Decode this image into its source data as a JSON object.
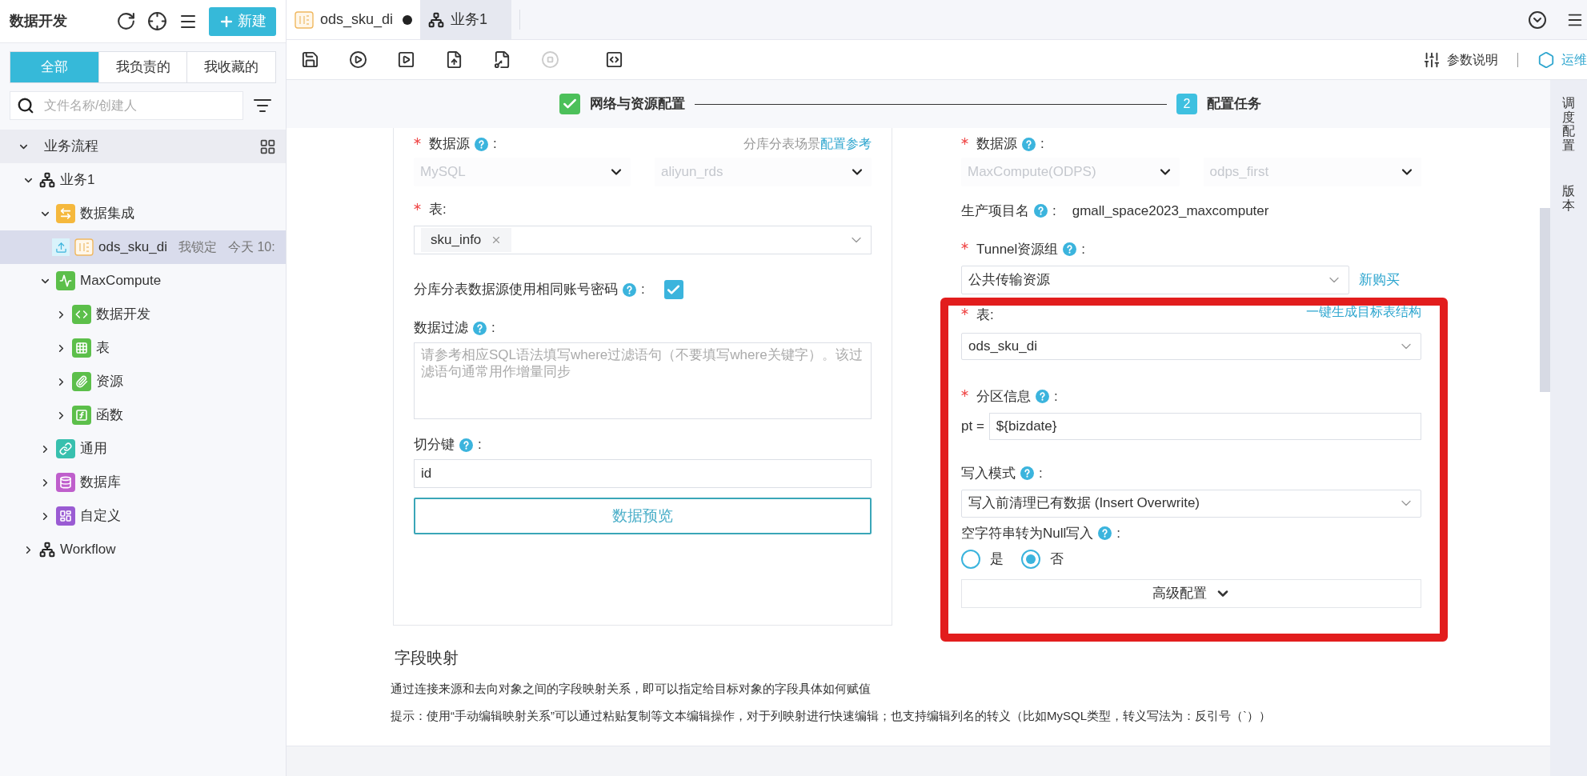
{
  "sidebar": {
    "title": "数据开发",
    "new_button": "新建",
    "filter_tabs": [
      {
        "label": "全部",
        "selected": true
      },
      {
        "label": "我负责的",
        "selected": false
      },
      {
        "label": "我收藏的",
        "selected": false
      }
    ],
    "search": {
      "placeholder": "文件名称/创建人"
    },
    "tree": [
      {
        "label": "业务流程",
        "kind": "section",
        "expanded": true,
        "selected": false,
        "children": [
          {
            "label": "业务1",
            "kind": "flow",
            "expanded": true,
            "selected": false,
            "children": [
              {
                "label": "数据集成",
                "kind": "integration",
                "expanded": true,
                "selected": false,
                "children": [
                  {
                    "label": "ods_sku_di",
                    "kind": "di",
                    "selected": true,
                    "lock": "我锁定",
                    "time": "今天 10:"
                  }
                ]
              },
              {
                "label": "MaxCompute",
                "kind": "maxcompute",
                "expanded": true,
                "selected": false,
                "children": [
                  {
                    "label": "数据开发",
                    "kind": "code",
                    "expanded": false,
                    "selected": false
                  },
                  {
                    "label": "表",
                    "kind": "table",
                    "expanded": false,
                    "selected": false
                  },
                  {
                    "label": "资源",
                    "kind": "resource",
                    "expanded": false,
                    "selected": false
                  },
                  {
                    "label": "函数",
                    "kind": "function",
                    "expanded": false,
                    "selected": false
                  }
                ]
              },
              {
                "label": "通用",
                "kind": "general",
                "expanded": false,
                "selected": false
              },
              {
                "label": "数据库",
                "kind": "database",
                "expanded": false,
                "selected": false
              },
              {
                "label": "自定义",
                "kind": "custom",
                "expanded": false,
                "selected": false
              }
            ]
          },
          {
            "label": "Workflow",
            "kind": "flow",
            "expanded": false,
            "selected": false
          }
        ]
      }
    ]
  },
  "editor_tabs": [
    {
      "label": "ods_sku_di",
      "kind": "di",
      "selected": true,
      "modified": true
    },
    {
      "label": "业务1",
      "kind": "flow",
      "selected": false,
      "modified": false
    }
  ],
  "toolbar": {
    "stop_disabled": true,
    "params_link": "参数说明",
    "ops_link": "运维"
  },
  "steps": [
    {
      "label": "网络与资源配置",
      "done": true
    },
    {
      "number": "2",
      "label": "配置任务",
      "done": false
    }
  ],
  "source": {
    "datasource_label": {
      "text": "数据源",
      "required": true,
      "help": true,
      "after": ":"
    },
    "hint_text": "分库分表场景",
    "hint_link": "配置参考",
    "type": "MySQL",
    "name": "aliyun_rds",
    "table_label": {
      "text": "表:",
      "required": true,
      "help": false
    },
    "tables": [
      "sku_info"
    ],
    "same_account_label": {
      "text": "分库分表数据源使用相同账号密码",
      "required": false,
      "help": true,
      "after": ":"
    },
    "same_account_checked": true,
    "filter_label": {
      "text": "数据过滤",
      "required": false,
      "help": true,
      "after": ":"
    },
    "filter_placeholder": "请参考相应SQL语法填写where过滤语句（不要填写where关键字）。该过滤语句通常用作增量同步",
    "split_label": {
      "text": "切分键",
      "required": false,
      "help": true,
      "after": ":"
    },
    "split_value": "id",
    "preview_button": "数据预览"
  },
  "target": {
    "datasource_label": {
      "text": "数据源",
      "required": true,
      "help": true,
      "after": ":"
    },
    "type": "MaxCompute(ODPS)",
    "name": "odps_first",
    "project_label": {
      "text": "生产项目名",
      "required": false,
      "help": true,
      "after": ":"
    },
    "project_value": "gmall_space2023_maxcomputer",
    "tunnel_label": {
      "text": "Tunnel资源组",
      "required": true,
      "help": true,
      "after": ":"
    },
    "tunnel_value": "公共传输资源",
    "buy_link": "新购买",
    "table_label": {
      "text": "表:",
      "required": true,
      "help": false
    },
    "generate_link": "一键生成目标表结构",
    "table_value": "ods_sku_di",
    "partition_label": {
      "text": "分区信息",
      "required": true,
      "help": true,
      "after": ":"
    },
    "partition_key": "pt =",
    "partition_value": "${bizdate}",
    "write_mode_label": {
      "text": "写入模式",
      "required": false,
      "help": true,
      "after": ":"
    },
    "write_mode_value": "写入前清理已有数据 (Insert Overwrite)",
    "null_label": {
      "text": "空字符串转为Null写入",
      "required": false,
      "help": true,
      "after": ":"
    },
    "null_options": [
      {
        "label": "是",
        "selected": false
      },
      {
        "label": "否",
        "selected": true
      }
    ],
    "advanced_button": "高级配置"
  },
  "mapping": {
    "title": "字段映射",
    "description": "通过连接来源和去向对象之间的字段映射关系，即可以指定给目标对象的字段具体如何赋值",
    "tip": "提示：使用“手动编辑映射关系”可以通过粘贴复制等文本编辑操作，对于列映射进行快速编辑；也支持编辑列名的转义（比如MySQL类型，转义写法为：反引号（`））"
  },
  "right_rail": [
    "调度配置",
    "版本"
  ]
}
